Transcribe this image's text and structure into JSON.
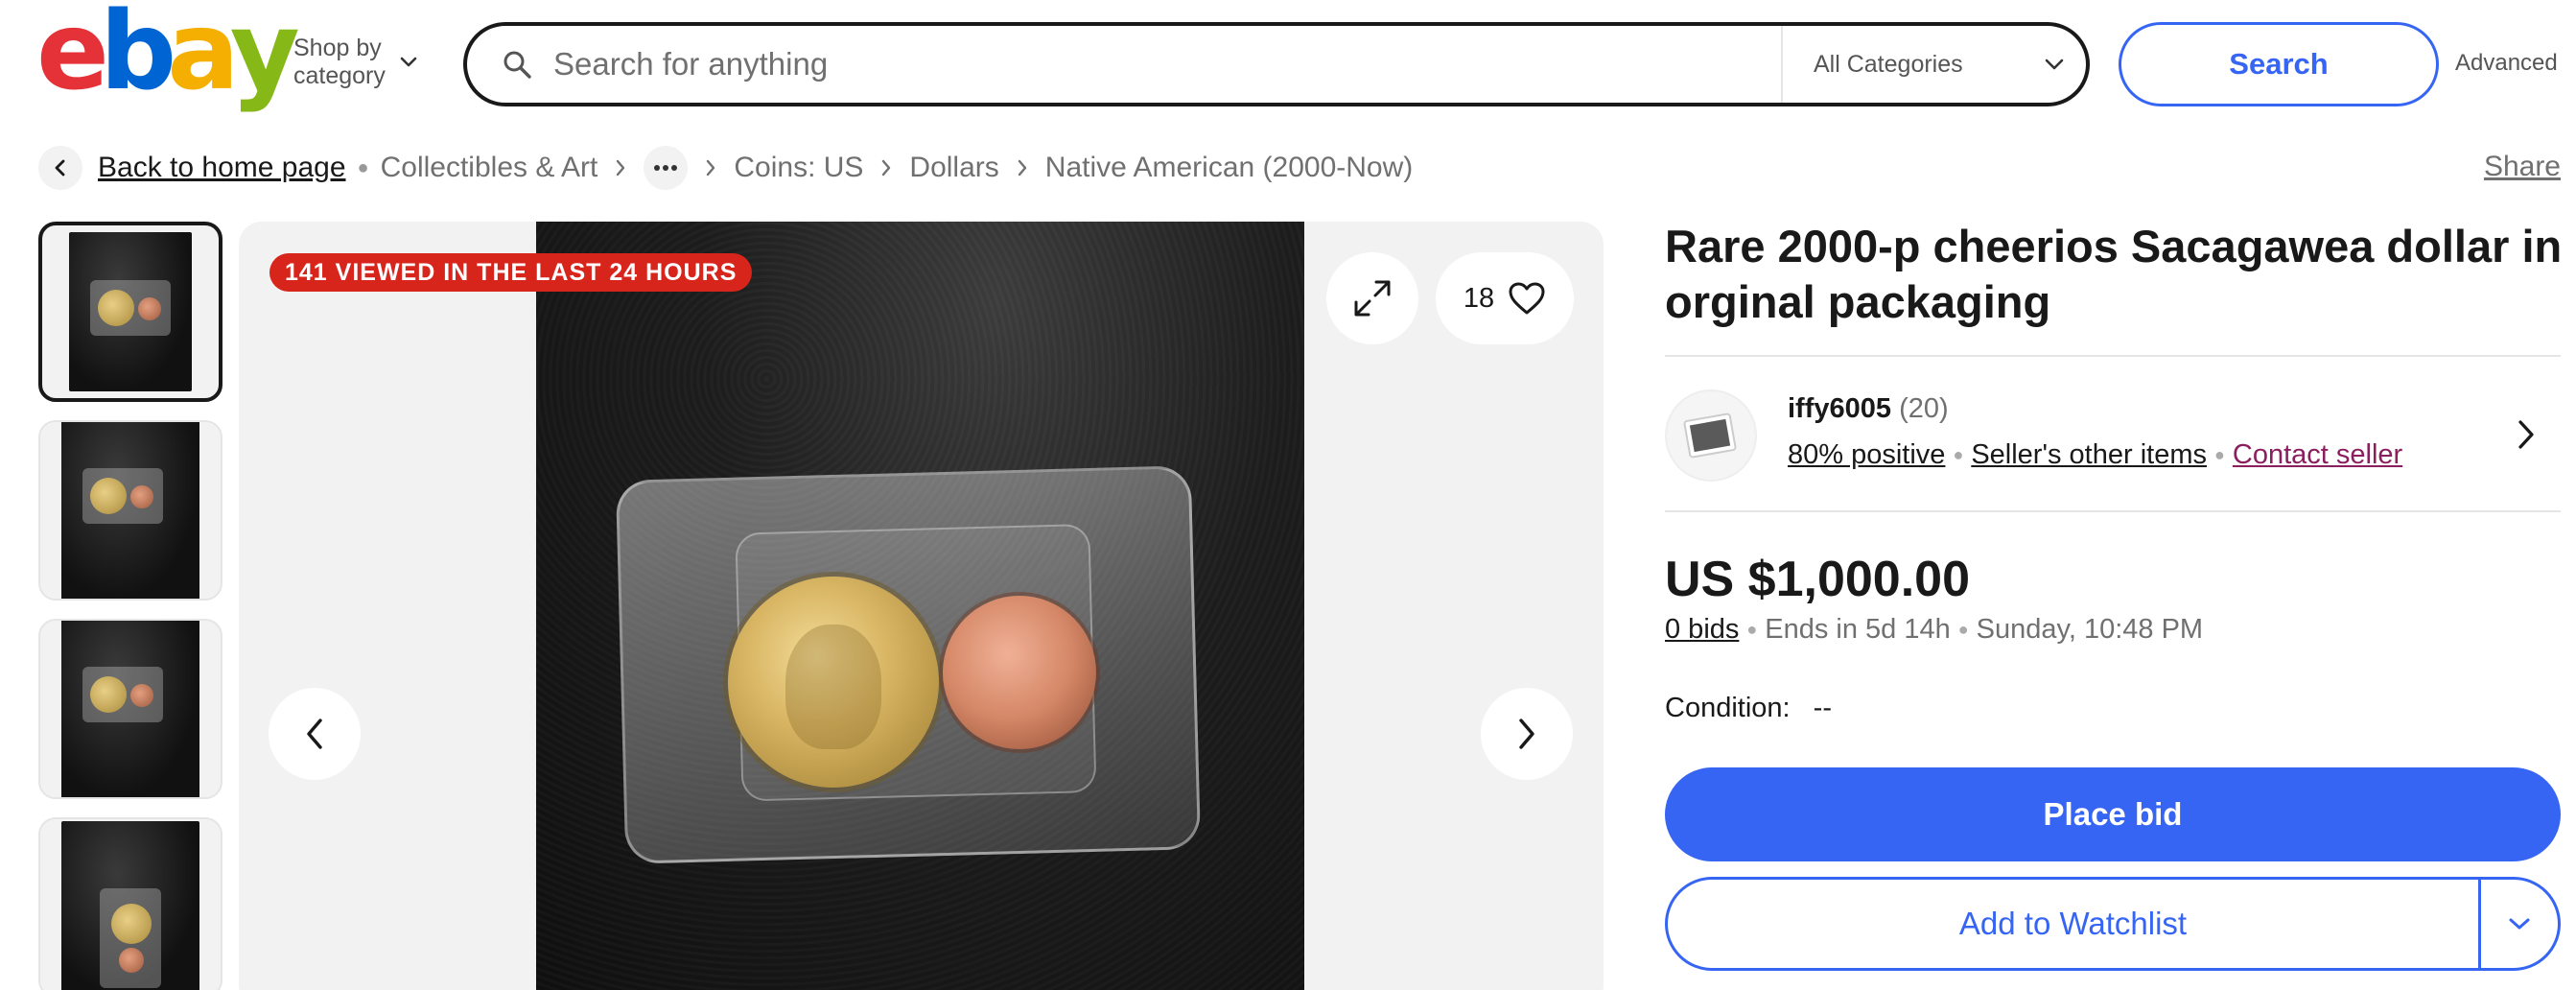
{
  "header": {
    "logo_letters": [
      {
        "char": "e",
        "color": "#e53238"
      },
      {
        "char": "b",
        "color": "#0064d2"
      },
      {
        "char": "a",
        "color": "#f5af02"
      },
      {
        "char": "y",
        "color": "#86b817"
      }
    ],
    "shop_by_line1": "Shop by",
    "shop_by_line2": "category",
    "search_placeholder": "Search for anything",
    "category_select": "All Categories",
    "search_button": "Search",
    "advanced_link": "Advanced"
  },
  "breadcrumb": {
    "back_label": "Back to home page",
    "items": [
      "Collectibles & Art",
      "Coins: US",
      "Dollars",
      "Native American (2000-Now)"
    ],
    "share": "Share"
  },
  "gallery": {
    "thumbnail_count": 4,
    "views_badge": "141 VIEWED IN THE LAST 24 HOURS",
    "watch_count": "18",
    "icons": [
      "expand-icon",
      "heart-icon",
      "chevron-left-icon",
      "chevron-right-icon"
    ]
  },
  "listing": {
    "title": "Rare 2000-p cheerios Sacagawea dollar in orginal packaging",
    "seller": {
      "name": "iffy6005",
      "feedback_count": "(20)",
      "positive": "80% positive",
      "other_items": "Seller's other items",
      "contact": "Contact seller"
    },
    "price": "US $1,000.00",
    "bids": "0 bids",
    "ends_in": "Ends in 5d 14h",
    "end_time": "Sunday, 10:48 PM",
    "condition_label": "Condition:",
    "condition_value": "--",
    "place_bid": "Place bid",
    "add_watchlist": "Add to Watchlist"
  },
  "colors": {
    "accent_blue": "#3665f3",
    "badge_red": "#d8251c",
    "contact_link": "#8a1e5e"
  }
}
